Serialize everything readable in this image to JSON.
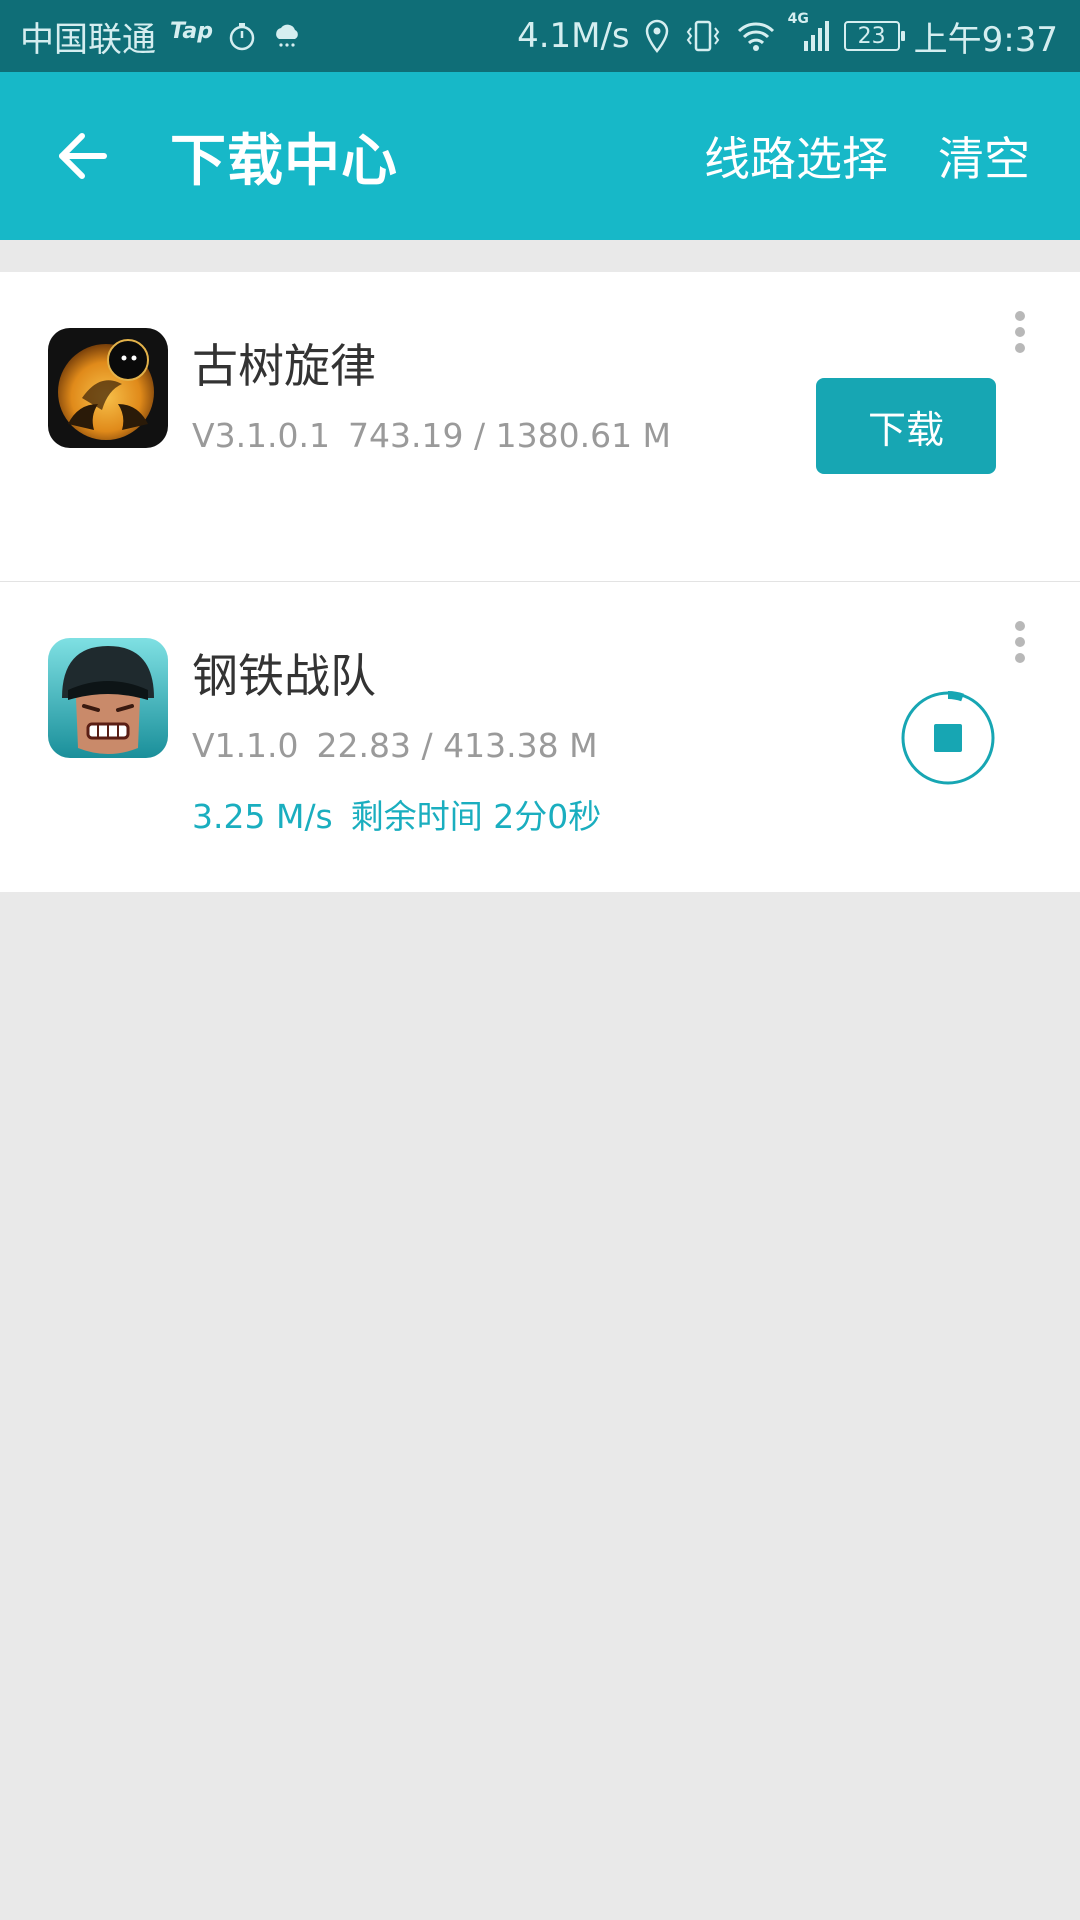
{
  "status_bar": {
    "carrier": "中国联通",
    "tap_label": "Tap",
    "net_speed": "4.1M/s",
    "network_label": "4G",
    "battery": "23",
    "time": "上午9:37"
  },
  "app_bar": {
    "title": "下载中心",
    "route_select": "线路选择",
    "clear": "清空"
  },
  "downloads": [
    {
      "name": "古树旋律",
      "version": "V3.1.0.1",
      "size": "743.19 / 1380.61 M",
      "action": "下载"
    },
    {
      "name": "钢铁战队",
      "version": "V1.1.0",
      "size": "22.83 / 413.38 M",
      "speed": "3.25 M/s",
      "remaining": "剩余时间 2分0秒",
      "progress": 0.055
    }
  ],
  "colors": {
    "accent": "#17b8c8",
    "status_bar": "#0f6e77",
    "button": "#17a6b3"
  }
}
